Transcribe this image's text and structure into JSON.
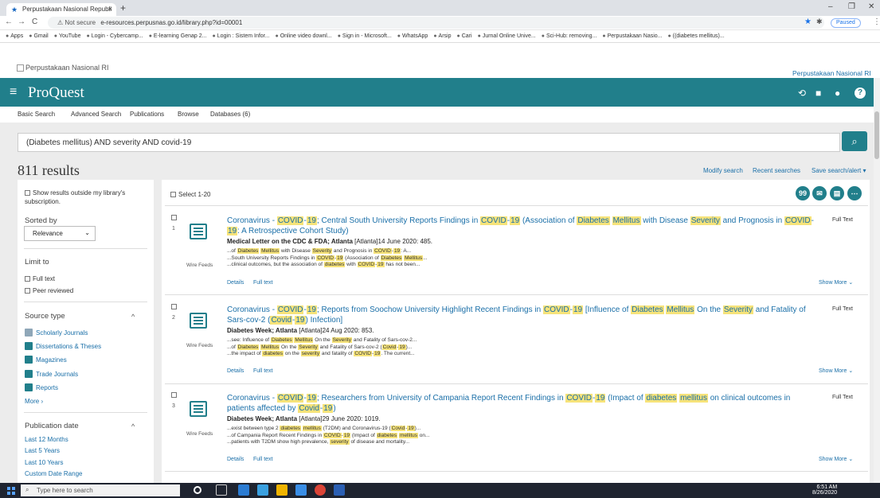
{
  "browser": {
    "tab_title": "Perpustakaan Nasional Republi",
    "tab_close": "×",
    "new_tab": "+",
    "back": "←",
    "forward": "→",
    "reload": "C",
    "not_secure": "⚠ Not secure",
    "url": "e-resources.perpusnas.go.id/library.php?id=00001",
    "paused": "Paused",
    "bookmarks": [
      "Apps",
      "Gmail",
      "YouTube",
      "Login - Cybercamp...",
      "E-learning Genap 2...",
      "Login : Sistem Infor...",
      "Online video downl...",
      "Sign in - Microsoft...",
      "WhatsApp",
      "Arsip",
      "Cari",
      "Jurnal Online Unive...",
      "Sci-Hub: removing...",
      "Perpustakaan Nasio...",
      "((diabetes mellitus)..."
    ]
  },
  "site": {
    "logo_alt": "Perpustakaan Nasional RI",
    "pn_link": "Perpustakaan Nasional RI"
  },
  "proquest": {
    "brand": "ProQuest",
    "nav": [
      "Basic Search",
      "Advanced Search",
      "Publications",
      "Browse",
      "Databases (6)"
    ],
    "query": "(Diabetes mellitus) AND severity AND covid-19",
    "result_count": "811 results",
    "top_links": {
      "modify": "Modify search",
      "recent": "Recent searches",
      "save": "Save search/alert ▾"
    }
  },
  "filters": {
    "outside": "Show results outside my library's subscription.",
    "sorted_by": "Sorted by",
    "sort_value": "Relevance",
    "limit_to": "Limit to",
    "full_text": "Full text",
    "peer": "Peer reviewed",
    "source_type": "Source type",
    "sources": [
      "Scholarly Journals",
      "Dissertations & Theses",
      "Magazines",
      "Trade Journals",
      "Reports"
    ],
    "more": "More ›",
    "pub_date": "Publication date",
    "dates": [
      "Last 12 Months",
      "Last 5 Years",
      "Last 10 Years",
      "Custom Date Range"
    ]
  },
  "results_header": {
    "select": "Select 1-20"
  },
  "results": [
    {
      "num": "1",
      "type": "Wire Feeds",
      "source": "Medical Letter on the CDC & FDA; Atlanta",
      "date": " [Atlanta]14 June 2020: 485.",
      "details": "Details",
      "fulltext_link": "Full text",
      "fulltext_badge": "Full Text",
      "show_more": "Show More ⌄"
    },
    {
      "num": "2",
      "type": "Wire Feeds",
      "source": "Diabetes Week; Atlanta",
      "date": " [Atlanta]24 Aug 2020: 853.",
      "details": "Details",
      "fulltext_link": "Full text",
      "fulltext_badge": "Full Text",
      "show_more": "Show More ⌄"
    },
    {
      "num": "3",
      "type": "Wire Feeds",
      "source": "Diabetes Week; Atlanta",
      "date": " [Atlanta]29 June 2020: 1019.",
      "details": "Details",
      "fulltext_link": "Full text",
      "fulltext_badge": "Full Text",
      "show_more": "Show More ⌄"
    }
  ],
  "taskbar": {
    "search": "Type here to search",
    "time": "6:51 AM",
    "date": "8/26/2020"
  }
}
